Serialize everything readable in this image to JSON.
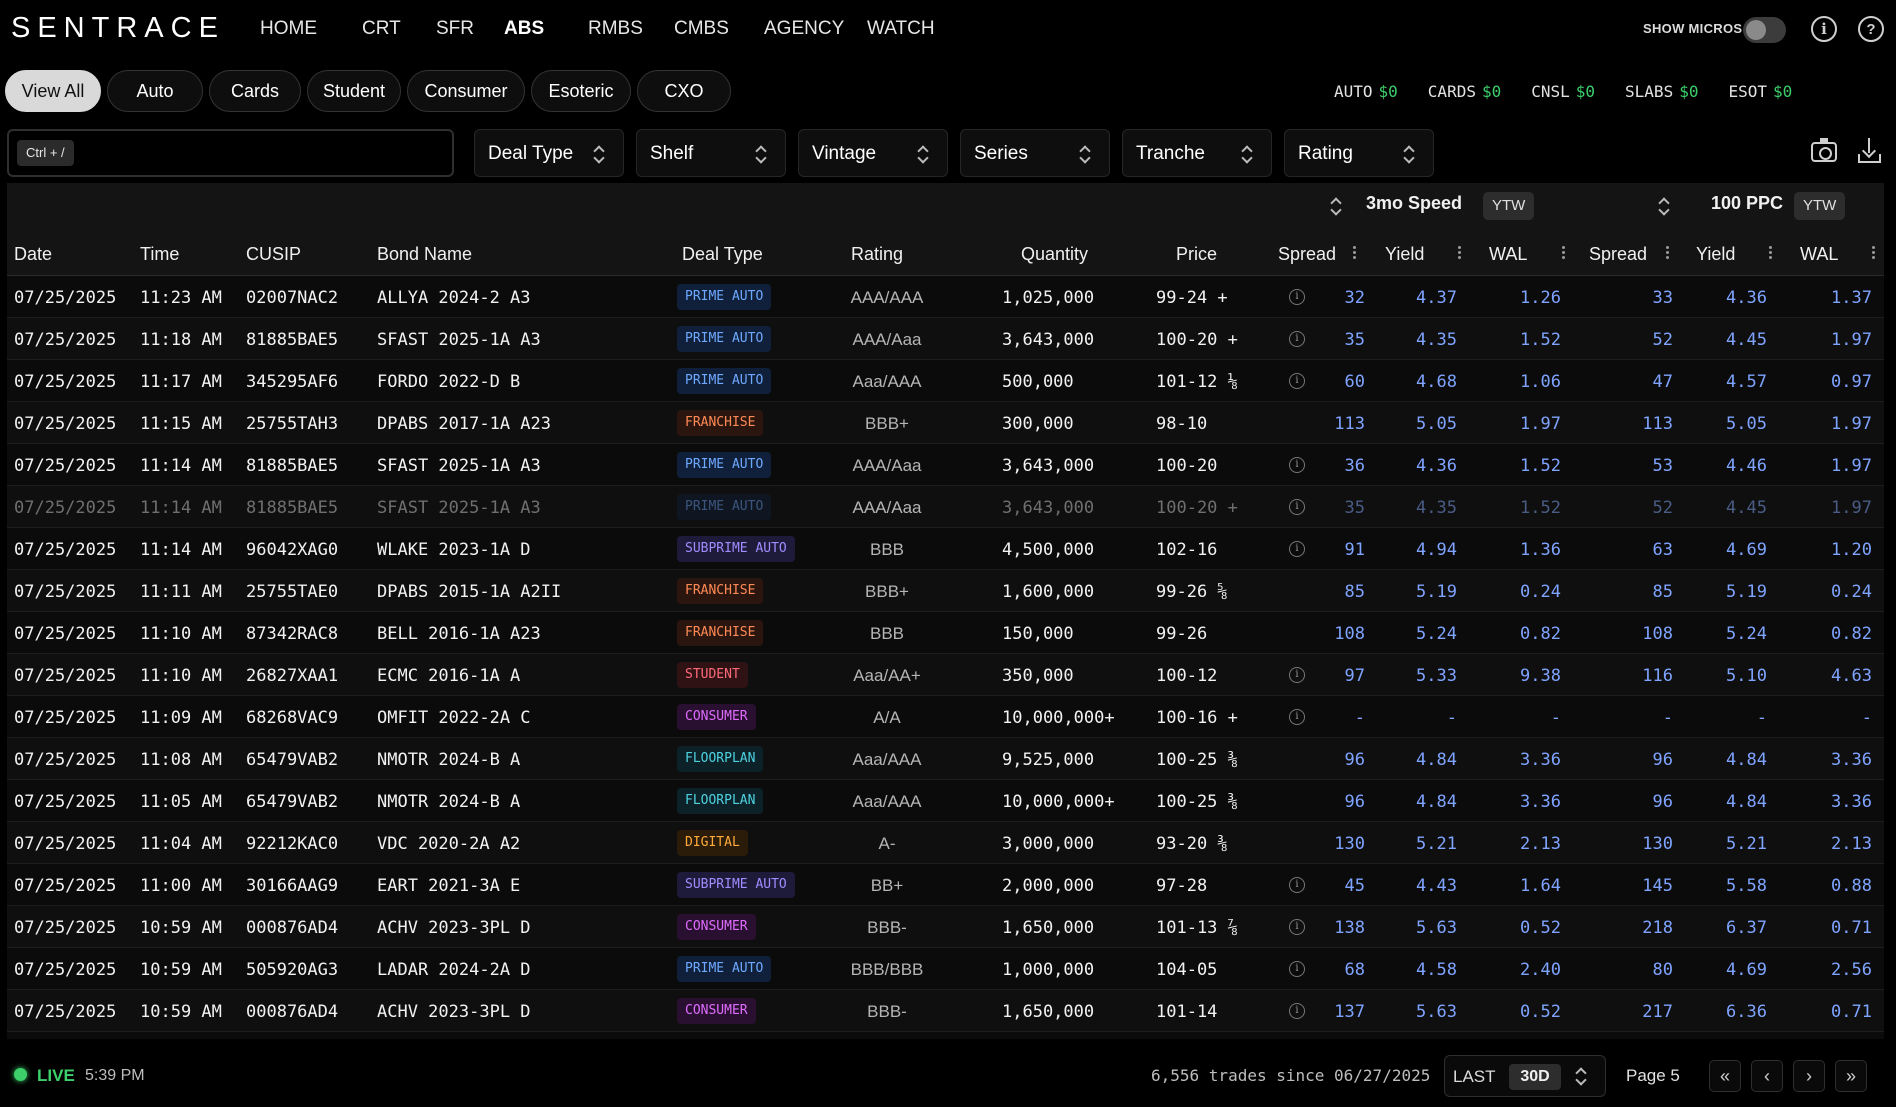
{
  "brand": "SENTRACE",
  "nav": [
    "HOME",
    "CRT",
    "SFR",
    "ABS",
    "RMBS",
    "CMBS",
    "AGENCY",
    "WATCH"
  ],
  "nav_active": "ABS",
  "show_micros_label": "SHOW MICROS",
  "show_micros_on": false,
  "info_icon": "i",
  "help_icon": "?",
  "categories": [
    "View All",
    "Auto",
    "Cards",
    "Student",
    "Consumer",
    "Esoteric",
    "CXO"
  ],
  "category_active": "View All",
  "totals": [
    {
      "label": "AUTO",
      "value": "$0"
    },
    {
      "label": "CARDS",
      "value": "$0"
    },
    {
      "label": "CNSL",
      "value": "$0"
    },
    {
      "label": "SLABS",
      "value": "$0"
    },
    {
      "label": "ESOT",
      "value": "$0"
    }
  ],
  "search": {
    "shortcut": "Ctrl + /",
    "value": ""
  },
  "filters": [
    "Deal Type",
    "Shelf",
    "Vintage",
    "Series",
    "Tranche",
    "Rating"
  ],
  "groups": {
    "speed_label": "3mo Speed",
    "speed_basis": "YTW",
    "ppc_label": "100 PPC",
    "ppc_basis": "YTW"
  },
  "columns": [
    "Date",
    "Time",
    "CUSIP",
    "Bond Name",
    "Deal Type",
    "Rating",
    "Quantity",
    "Price",
    "Spread",
    "Yield",
    "WAL",
    "Spread",
    "Yield",
    "WAL"
  ],
  "colors": {
    "accent_green": "#3ccf6a",
    "metric_blue": "#7fa4ff"
  },
  "rows": [
    {
      "date": "07/25/2025",
      "time": "11:23 AM",
      "cusip": "02007NAC2",
      "bond": "ALLYA 2024-2 A3",
      "deal_type": "PRIME AUTO",
      "badge": "b-prime",
      "rating": "AAA/AAA",
      "quantity": "1,025,000",
      "price": "99-24 +",
      "info": true,
      "spread1": "32",
      "yield1": "4.37",
      "wal1": "1.26",
      "spread2": "33",
      "yield2": "4.36",
      "wal2": "1.37",
      "struck": false
    },
    {
      "date": "07/25/2025",
      "time": "11:18 AM",
      "cusip": "81885BAE5",
      "bond": "SFAST 2025-1A A3",
      "deal_type": "PRIME AUTO",
      "badge": "b-prime",
      "rating": "AAA/Aaa",
      "quantity": "3,643,000",
      "price": "100-20 +",
      "info": true,
      "spread1": "35",
      "yield1": "4.35",
      "wal1": "1.52",
      "spread2": "52",
      "yield2": "4.45",
      "wal2": "1.97",
      "struck": false
    },
    {
      "date": "07/25/2025",
      "time": "11:17 AM",
      "cusip": "345295AF6",
      "bond": "FORDO 2022-D B",
      "deal_type": "PRIME AUTO",
      "badge": "b-prime",
      "rating": "Aaa/AAA",
      "quantity": "500,000",
      "price": "101-12 ⅛",
      "info": true,
      "spread1": "60",
      "yield1": "4.68",
      "wal1": "1.06",
      "spread2": "47",
      "yield2": "4.57",
      "wal2": "0.97",
      "struck": false
    },
    {
      "date": "07/25/2025",
      "time": "11:15 AM",
      "cusip": "25755TAH3",
      "bond": "DPABS 2017-1A A23",
      "deal_type": "FRANCHISE",
      "badge": "b-fran",
      "rating": "BBB+",
      "quantity": "300,000",
      "price": "98-10",
      "info": false,
      "spread1": "113",
      "yield1": "5.05",
      "wal1": "1.97",
      "spread2": "113",
      "yield2": "5.05",
      "wal2": "1.97",
      "struck": false
    },
    {
      "date": "07/25/2025",
      "time": "11:14 AM",
      "cusip": "81885BAE5",
      "bond": "SFAST 2025-1A A3",
      "deal_type": "PRIME AUTO",
      "badge": "b-prime",
      "rating": "AAA/Aaa",
      "quantity": "3,643,000",
      "price": "100-20",
      "info": true,
      "spread1": "36",
      "yield1": "4.36",
      "wal1": "1.52",
      "spread2": "53",
      "yield2": "4.46",
      "wal2": "1.97",
      "struck": false
    },
    {
      "date": "07/25/2025",
      "time": "11:14 AM",
      "cusip": "81885BAE5",
      "bond": "SFAST 2025-1A A3",
      "deal_type": "PRIME AUTO",
      "badge": "b-prime",
      "rating": "AAA/Aaa",
      "quantity": "3,643,000",
      "price": "100-20 +",
      "info": true,
      "spread1": "35",
      "yield1": "4.35",
      "wal1": "1.52",
      "spread2": "52",
      "yield2": "4.45",
      "wal2": "1.97",
      "struck": true
    },
    {
      "date": "07/25/2025",
      "time": "11:14 AM",
      "cusip": "96042XAG0",
      "bond": "WLAKE 2023-1A D",
      "deal_type": "SUBPRIME AUTO",
      "badge": "b-sub",
      "rating": "BBB",
      "quantity": "4,500,000",
      "price": "102-16",
      "info": true,
      "spread1": "91",
      "yield1": "4.94",
      "wal1": "1.36",
      "spread2": "63",
      "yield2": "4.69",
      "wal2": "1.20",
      "struck": false
    },
    {
      "date": "07/25/2025",
      "time": "11:11 AM",
      "cusip": "25755TAE0",
      "bond": "DPABS 2015-1A A2II",
      "deal_type": "FRANCHISE",
      "badge": "b-fran",
      "rating": "BBB+",
      "quantity": "1,600,000",
      "price": "99-26 ⅝",
      "info": false,
      "spread1": "85",
      "yield1": "5.19",
      "wal1": "0.24",
      "spread2": "85",
      "yield2": "5.19",
      "wal2": "0.24",
      "struck": false
    },
    {
      "date": "07/25/2025",
      "time": "11:10 AM",
      "cusip": "87342RAC8",
      "bond": "BELL 2016-1A A23",
      "deal_type": "FRANCHISE",
      "badge": "b-fran",
      "rating": "BBB",
      "quantity": "150,000",
      "price": "99-26",
      "info": false,
      "spread1": "108",
      "yield1": "5.24",
      "wal1": "0.82",
      "spread2": "108",
      "yield2": "5.24",
      "wal2": "0.82",
      "struck": false
    },
    {
      "date": "07/25/2025",
      "time": "11:10 AM",
      "cusip": "26827XAA1",
      "bond": "ECMC 2016-1A A",
      "deal_type": "STUDENT",
      "badge": "b-stu",
      "rating": "Aaa/AA+",
      "quantity": "350,000",
      "price": "100-12",
      "info": true,
      "spread1": "97",
      "yield1": "5.33",
      "wal1": "9.38",
      "spread2": "116",
      "yield2": "5.10",
      "wal2": "4.63",
      "struck": false
    },
    {
      "date": "07/25/2025",
      "time": "11:09 AM",
      "cusip": "68268VAC9",
      "bond": "OMFIT 2022-2A C",
      "deal_type": "CONSUMER",
      "badge": "b-con",
      "rating": "A/A",
      "quantity": "10,000,000+",
      "price": "100-16 +",
      "info": true,
      "spread1": "-",
      "yield1": "-",
      "wal1": "-",
      "spread2": "-",
      "yield2": "-",
      "wal2": "-",
      "struck": false
    },
    {
      "date": "07/25/2025",
      "time": "11:08 AM",
      "cusip": "65479VAB2",
      "bond": "NMOTR 2024-B A",
      "deal_type": "FLOORPLAN",
      "badge": "b-floor",
      "rating": "Aaa/AAA",
      "quantity": "9,525,000",
      "price": "100-25 ⅜",
      "info": false,
      "spread1": "96",
      "yield1": "4.84",
      "wal1": "3.36",
      "spread2": "96",
      "yield2": "4.84",
      "wal2": "3.36",
      "struck": false
    },
    {
      "date": "07/25/2025",
      "time": "11:05 AM",
      "cusip": "65479VAB2",
      "bond": "NMOTR 2024-B A",
      "deal_type": "FLOORPLAN",
      "badge": "b-floor",
      "rating": "Aaa/AAA",
      "quantity": "10,000,000+",
      "price": "100-25 ⅜",
      "info": false,
      "spread1": "96",
      "yield1": "4.84",
      "wal1": "3.36",
      "spread2": "96",
      "yield2": "4.84",
      "wal2": "3.36",
      "struck": false
    },
    {
      "date": "07/25/2025",
      "time": "11:04 AM",
      "cusip": "92212KAC0",
      "bond": "VDC 2020-2A A2",
      "deal_type": "DIGITAL",
      "badge": "b-dig",
      "rating": "A-",
      "quantity": "3,000,000",
      "price": "93-20 ⅜",
      "info": false,
      "spread1": "130",
      "yield1": "5.21",
      "wal1": "2.13",
      "spread2": "130",
      "yield2": "5.21",
      "wal2": "2.13",
      "struck": false
    },
    {
      "date": "07/25/2025",
      "time": "11:00 AM",
      "cusip": "30166AAG9",
      "bond": "EART 2021-3A E",
      "deal_type": "SUBPRIME AUTO",
      "badge": "b-sub",
      "rating": "BB+",
      "quantity": "2,000,000",
      "price": "97-28",
      "info": true,
      "spread1": "45",
      "yield1": "4.43",
      "wal1": "1.64",
      "spread2": "145",
      "yield2": "5.58",
      "wal2": "0.88",
      "struck": false
    },
    {
      "date": "07/25/2025",
      "time": "10:59 AM",
      "cusip": "000876AD4",
      "bond": "ACHV 2023-3PL D",
      "deal_type": "CONSUMER",
      "badge": "b-con",
      "rating": "BBB-",
      "quantity": "1,650,000",
      "price": "101-13 ⅞",
      "info": true,
      "spread1": "138",
      "yield1": "5.63",
      "wal1": "0.52",
      "spread2": "218",
      "yield2": "6.37",
      "wal2": "0.71",
      "struck": false
    },
    {
      "date": "07/25/2025",
      "time": "10:59 AM",
      "cusip": "505920AG3",
      "bond": "LADAR 2024-2A D",
      "deal_type": "PRIME AUTO",
      "badge": "b-prime",
      "rating": "BBB/BBB",
      "quantity": "1,000,000",
      "price": "104-05",
      "info": true,
      "spread1": "68",
      "yield1": "4.58",
      "wal1": "2.40",
      "spread2": "80",
      "yield2": "4.69",
      "wal2": "2.56",
      "struck": false
    },
    {
      "date": "07/25/2025",
      "time": "10:59 AM",
      "cusip": "000876AD4",
      "bond": "ACHV 2023-3PL D",
      "deal_type": "CONSUMER",
      "badge": "b-con",
      "rating": "BBB-",
      "quantity": "1,650,000",
      "price": "101-14",
      "info": true,
      "spread1": "137",
      "yield1": "5.63",
      "wal1": "0.52",
      "spread2": "217",
      "yield2": "6.36",
      "wal2": "0.71",
      "struck": false
    }
  ],
  "footer": {
    "live_label": "LIVE",
    "live_time": "5:39 PM",
    "trades_summary": "6,556 trades since 06/27/2025",
    "range_prefix": "LAST",
    "range_value": "30D",
    "page_label": "Page 5",
    "first_icon": "«",
    "prev_icon": "‹",
    "next_icon": "›",
    "last_icon": "»"
  }
}
